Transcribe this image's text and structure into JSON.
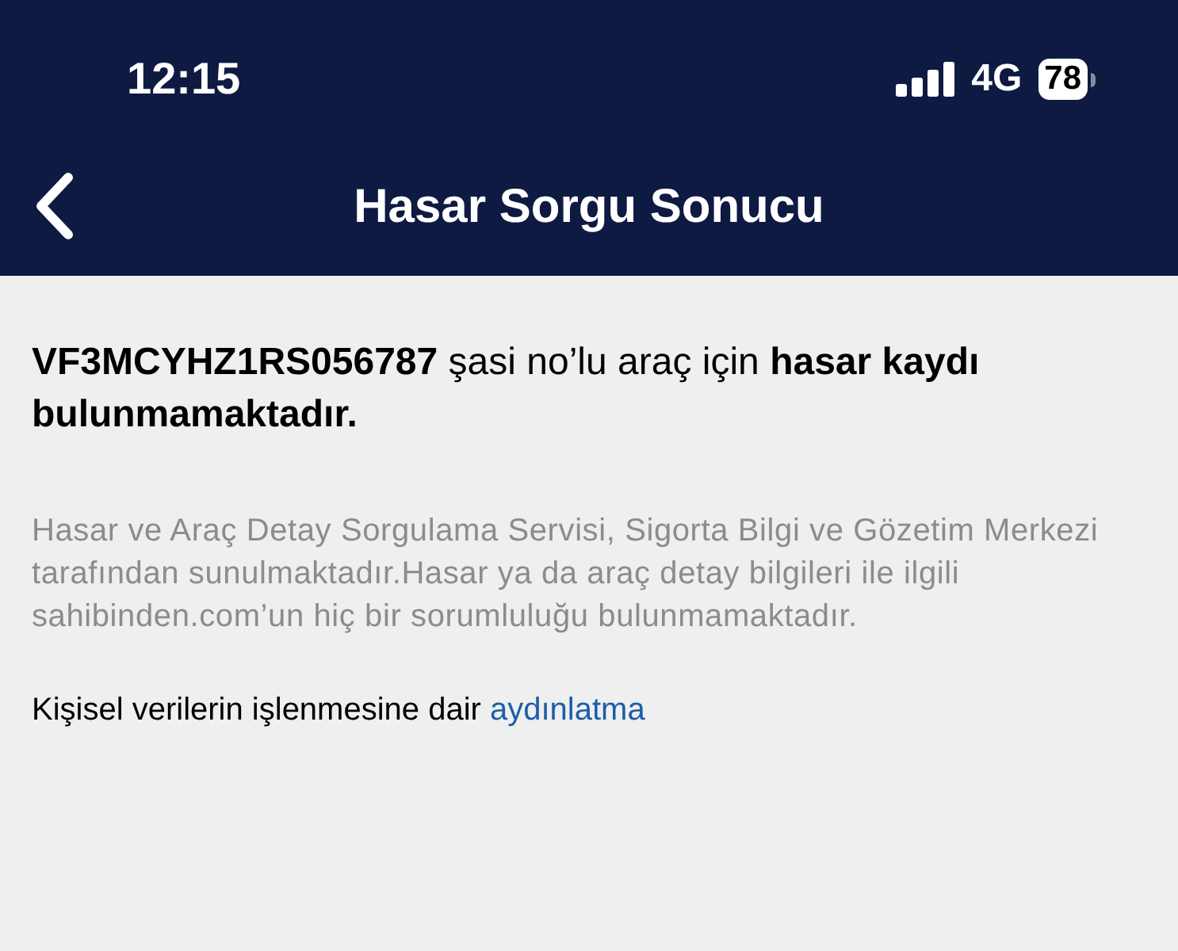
{
  "status_bar": {
    "time": "12:15",
    "network": "4G",
    "battery": "78"
  },
  "nav": {
    "title": "Hasar Sorgu Sonucu"
  },
  "result": "**VF3MCYHZ1RS056787** şasi no’lu araç için **hasar kaydı bulunmamaktadır.**",
  "disclaimer": "Hasar ve Araç Detay Sorgulama Servisi, Sigorta Bilgi ve Gözetim Merkezi tarafından sunulmaktadır.Hasar ya da araç detay bilgileri ile ilgili sahibinden.com’un hiç bir sorumluluğu bulunmamaktadır.",
  "privacy": {
    "text": "Kişisel verilerin işlenmesine dair",
    "link": "aydınlatma"
  }
}
